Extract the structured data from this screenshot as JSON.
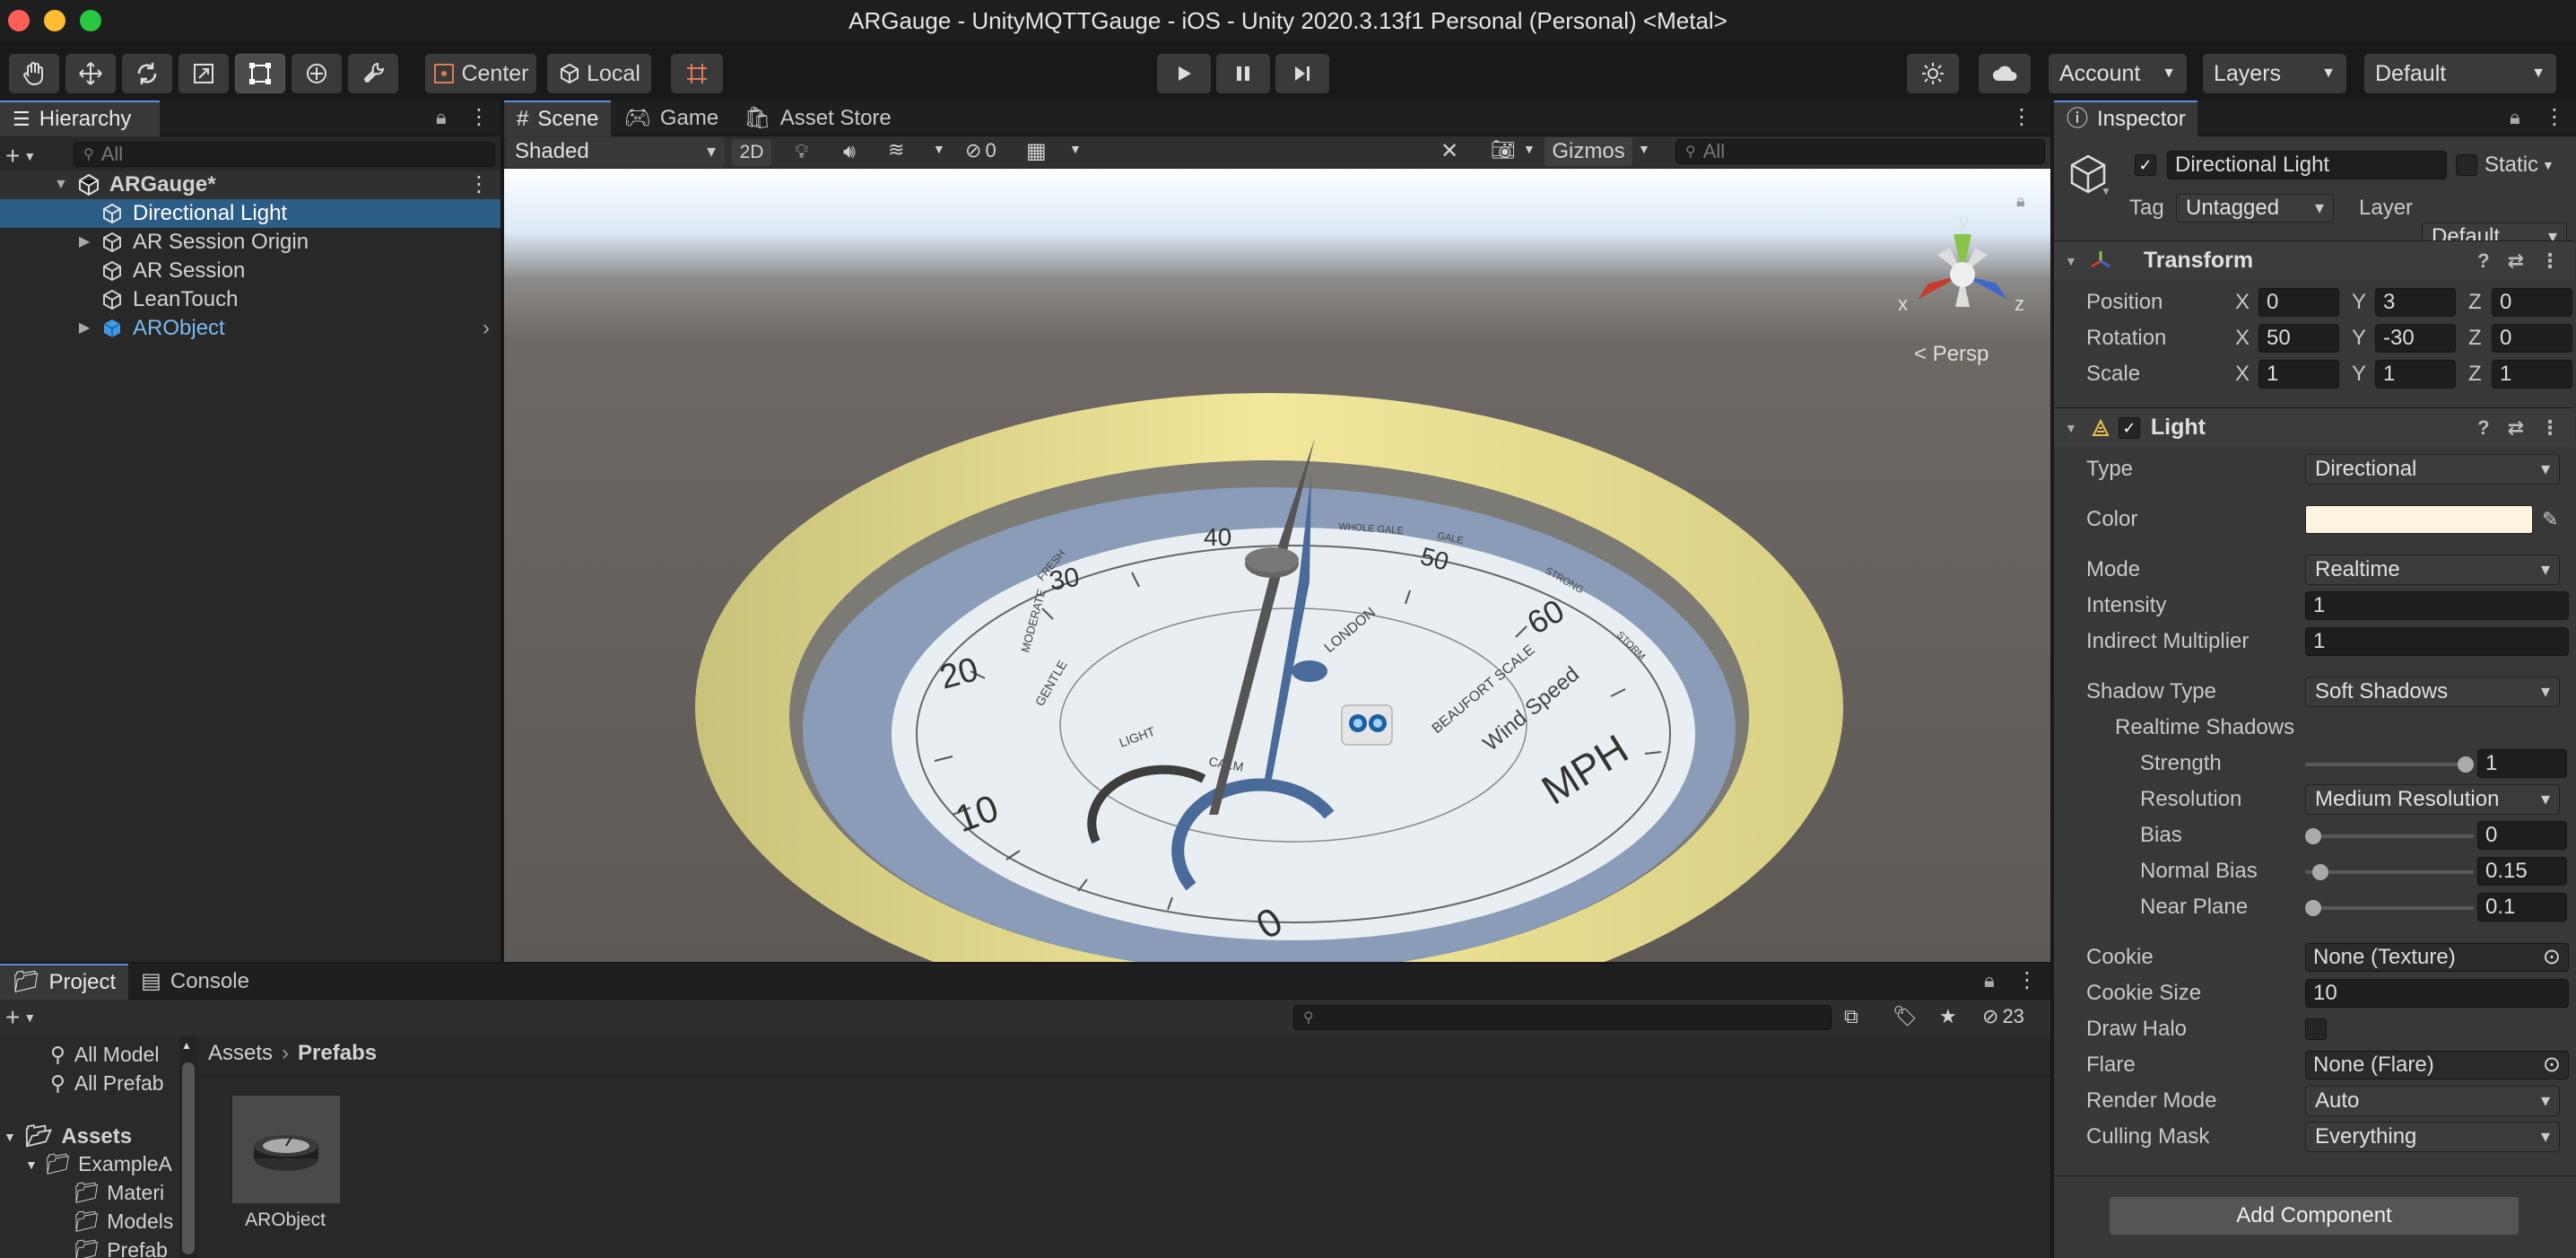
{
  "window": {
    "title": "ARGauge - UnityMQTTGauge - iOS - Unity 2020.3.13f1 Personal (Personal) <Metal>"
  },
  "toolbar": {
    "pivot_label": "Center",
    "space_label": "Local",
    "account_label": "Account",
    "layers_label": "Layers",
    "layout_label": "Default"
  },
  "hierarchy": {
    "tab_label": "Hierarchy",
    "search_placeholder": "All",
    "scene_name": "ARGauge*",
    "items": [
      {
        "label": "Directional Light"
      },
      {
        "label": "AR Session Origin"
      },
      {
        "label": "AR Session"
      },
      {
        "label": "LeanTouch"
      },
      {
        "label": "ARObject"
      }
    ]
  },
  "scene_view": {
    "tabs": [
      {
        "label": "Scene"
      },
      {
        "label": "Game"
      },
      {
        "label": "Asset Store"
      }
    ],
    "shading_mode": "Shaded",
    "mode_2d": "2D",
    "hidden_count": "0",
    "gizmos_label": "Gizmos",
    "search_placeholder": "All",
    "projection_label": "< Persp",
    "axis_x": "x",
    "axis_y": "y",
    "axis_z": "z"
  },
  "gauge": {
    "tick_labels": [
      "0",
      "10",
      "20",
      "30",
      "40",
      "50",
      "60"
    ],
    "unit": "MPH",
    "caption": "Wind Speed",
    "scale_name": "BEAUFORT SCALE",
    "city": "LONDON",
    "bands": [
      "CALM",
      "LIGHT",
      "GENTLE",
      "MODERATE",
      "FRESH",
      "STRONG",
      "GALE",
      "WHOLE GALE",
      "STORM"
    ]
  },
  "inspector": {
    "tab_label": "Inspector",
    "object_name": "Directional Light",
    "static_label": "Static",
    "tag_label": "Tag",
    "tag_value": "Untagged",
    "layer_label": "Layer",
    "layer_value": "Default",
    "transform": {
      "title": "Transform",
      "position_label": "Position",
      "rotation_label": "Rotation",
      "scale_label": "Scale",
      "position": {
        "x": "0",
        "y": "3",
        "z": "0"
      },
      "rotation": {
        "x": "50",
        "y": "-30",
        "z": "0"
      },
      "scale": {
        "x": "1",
        "y": "1",
        "z": "1"
      }
    },
    "light": {
      "title": "Light",
      "type_label": "Type",
      "type_value": "Directional",
      "color_label": "Color",
      "color_value": "#FFF4E0",
      "mode_label": "Mode",
      "mode_value": "Realtime",
      "intensity_label": "Intensity",
      "intensity_value": "1",
      "indirect_label": "Indirect Multiplier",
      "indirect_value": "1",
      "shadow_type_label": "Shadow Type",
      "shadow_type_value": "Soft Shadows",
      "realtime_shadows_label": "Realtime Shadows",
      "strength_label": "Strength",
      "strength_value": "1",
      "resolution_label": "Resolution",
      "resolution_value": "Medium Resolution",
      "bias_label": "Bias",
      "bias_value": "0",
      "normal_bias_label": "Normal Bias",
      "normal_bias_value": "0.15",
      "near_plane_label": "Near Plane",
      "near_plane_value": "0.1",
      "cookie_label": "Cookie",
      "cookie_value": "None (Texture)",
      "cookie_size_label": "Cookie Size",
      "cookie_size_value": "10",
      "draw_halo_label": "Draw Halo",
      "flare_label": "Flare",
      "flare_value": "None (Flare)",
      "render_mode_label": "Render Mode",
      "render_mode_value": "Auto",
      "culling_mask_label": "Culling Mask",
      "culling_mask_value": "Everything"
    },
    "add_component_label": "Add Component"
  },
  "project": {
    "tabs": [
      {
        "label": "Project"
      },
      {
        "label": "Console"
      }
    ],
    "hidden_count": "23",
    "favorites": [
      {
        "label": "All Model"
      },
      {
        "label": "All Prefab"
      }
    ],
    "assets_root": "Assets",
    "tree": [
      {
        "label": "ExampleA"
      },
      {
        "label": "Materi"
      },
      {
        "label": "Models"
      },
      {
        "label": "Prefab"
      }
    ],
    "breadcrumb": {
      "root": "Assets",
      "current": "Prefabs"
    },
    "asset_items": [
      {
        "label": "ARObject"
      }
    ]
  }
}
